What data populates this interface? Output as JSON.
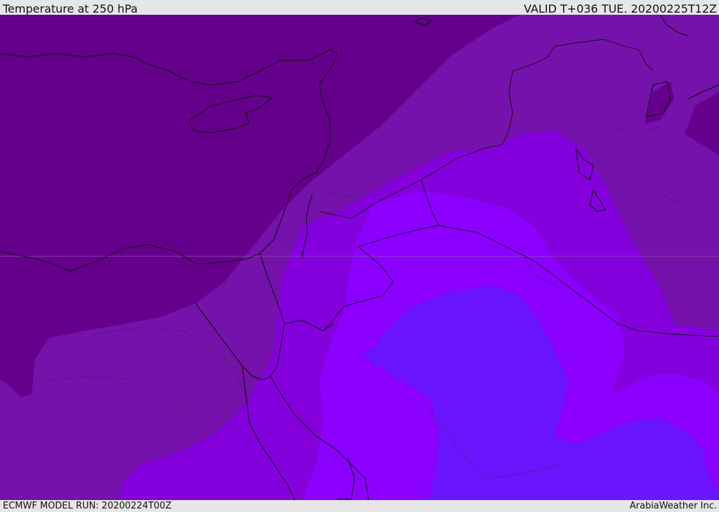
{
  "header": {
    "title": "Temperature at 250 hPa",
    "valid": "VALID T+036 TUE. 20200225T12Z"
  },
  "footer": {
    "model_run": "ECMWF MODEL RUN: 20200224T00Z",
    "credit": "ArabiaWeather Inc."
  },
  "colors": {
    "band_coldest": "#64008c",
    "band_cold": "#7512ab",
    "band_mid": "#8400dc",
    "band_warm": "#8b00ff",
    "band_warmest": "#6b15ff",
    "coastline": "#111111",
    "frame": "#e6e6e6"
  }
}
